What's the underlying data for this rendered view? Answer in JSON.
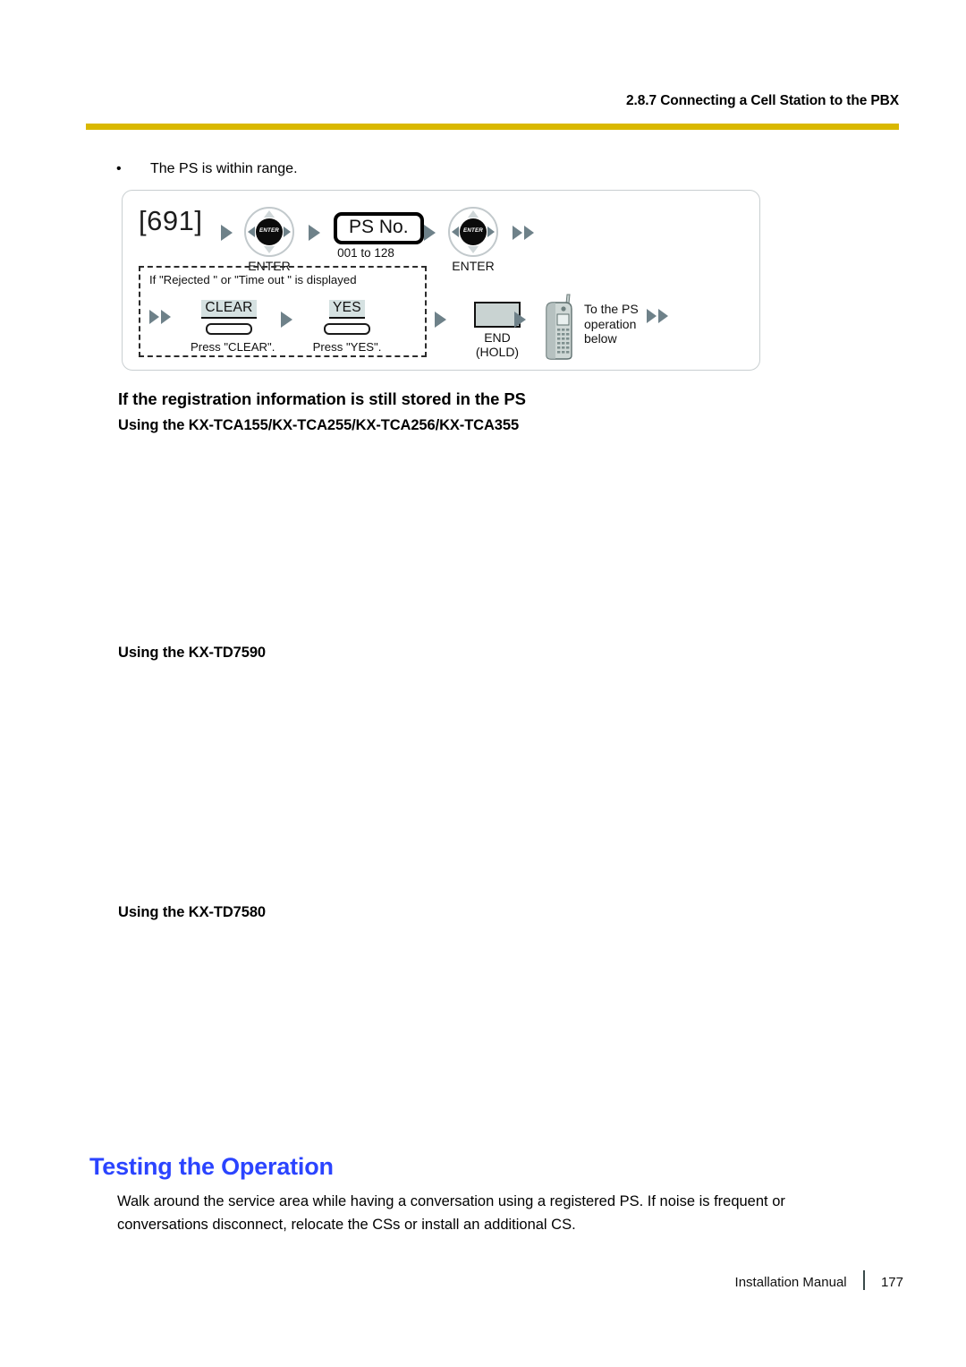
{
  "header": {
    "section_title": "2.8.7 Connecting a Cell Station to the PBX",
    "rule_color": "#d9b800"
  },
  "bullet": {
    "marker": "•",
    "text": "The PS is within range."
  },
  "flow_diagram": {
    "feature_code": "[691]",
    "enter_key_1": {
      "hub_label": "ENTER",
      "caption": "ENTER"
    },
    "ps_no_display": {
      "label": "PS No.",
      "range": "001 to 128"
    },
    "enter_key_2": {
      "hub_label": "ENTER",
      "caption": "ENTER"
    },
    "conditional_box": {
      "condition_text": "If \"Rejected  \" or \"Time out  \" is displayed",
      "clear_key": {
        "label": "CLEAR",
        "caption": "Press \"CLEAR\"."
      },
      "yes_key": {
        "label": "YES",
        "caption": "Press \"YES\"."
      }
    },
    "end_key": {
      "line1": "END",
      "line2": "(HOLD)"
    },
    "handset_note": "To the PS\noperation\nbelow",
    "handset_note_lines": [
      "To the PS",
      "operation",
      "below"
    ]
  },
  "headings": {
    "registration_stored": "If the registration information is still stored in the PS",
    "using_tca": "Using the KX-TCA155/KX-TCA255/KX-TCA256/KX-TCA355",
    "using_td7590": "Using the KX-TD7590",
    "using_td7580": "Using the KX-TD7580"
  },
  "testing_section": {
    "title": "Testing the Operation",
    "title_color": "#2b44ff",
    "paragraph": "Walk around the service area while having a conversation using a registered PS. If noise is frequent or conversations disconnect, relocate the CSs or install an additional CS."
  },
  "footer": {
    "manual_name": "Installation Manual",
    "page_number": "177"
  }
}
